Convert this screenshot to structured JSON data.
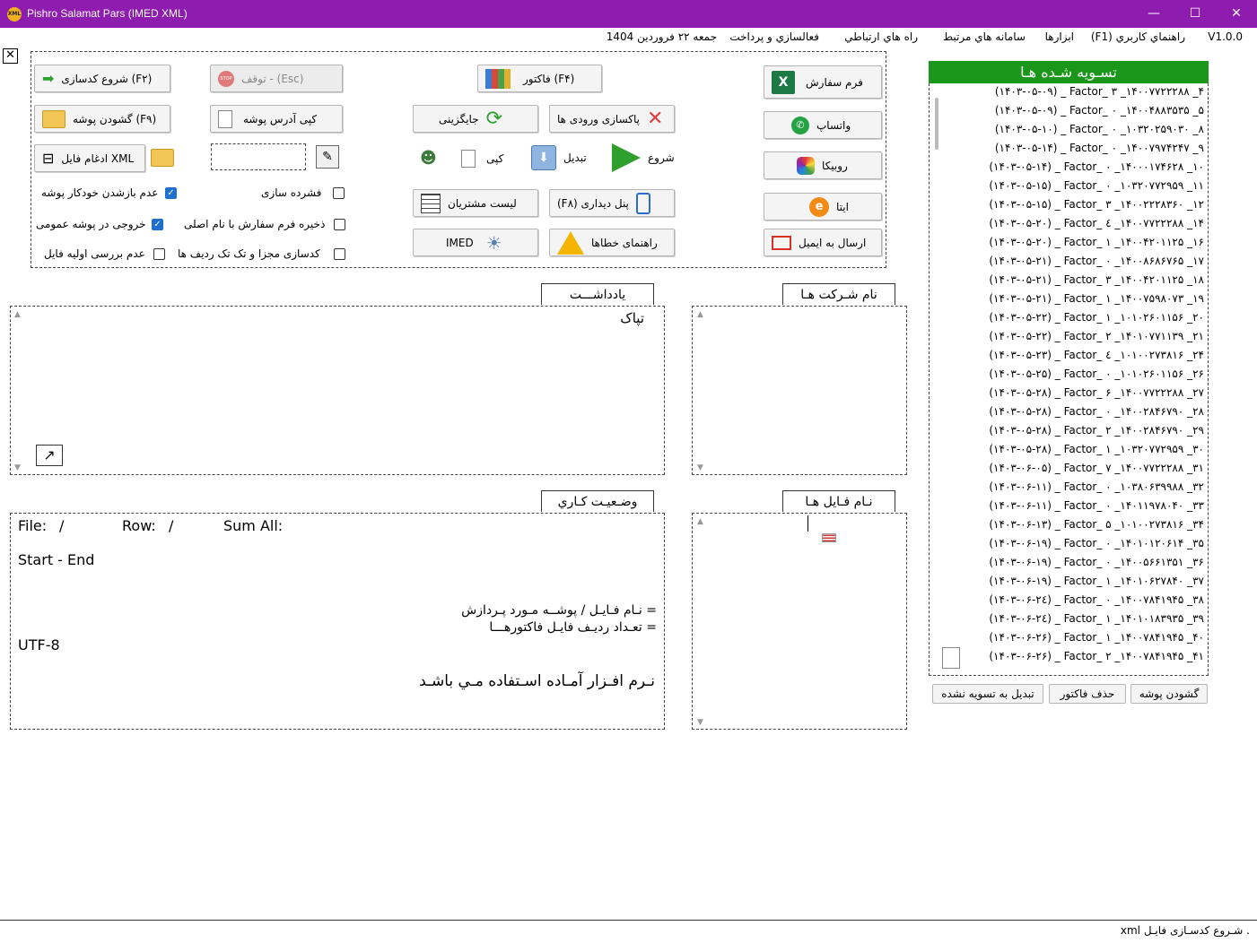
{
  "window": {
    "title": "Pishro Salamat Pars (IMED XML)",
    "app_icon_text": "XML",
    "minimize": "—",
    "maximize": "☐",
    "close": "✕"
  },
  "menu": {
    "version": "V1.0.0",
    "help": "(F1) راهنماي كاربري",
    "tools": "ابزارها",
    "related_systems": "سامانه هاي مرتبط",
    "contact": "راه هاي ارتباطي",
    "activation": "فعالسازي و پرداخت",
    "date": "جمعه ۲۲ فروردین 1404"
  },
  "toolbar": {
    "start_coding": "شروع کدسازی (F۲)",
    "stop": "توقف - (Esc)",
    "invoice": "فاکتور (F۴)",
    "order_form": "فرم سفارش",
    "open_folder": "گشودن پوشه (F۹)",
    "copy_folder_address": "کپی آدرس پوشه",
    "replace": "جایگزینی",
    "clear_inputs": "پاکسازی ورودی ها",
    "whatsapp": "واتساپ",
    "merge_xml": "ادغام فایل XML",
    "copy": "کپی",
    "convert": "تبدیل",
    "start": "شروع",
    "rubika": "روبیکا",
    "customer_list": "لیست مشتریان",
    "view_panel": "(F۸)  پنل دیداری",
    "eita": "ایتا",
    "imed": "IMED",
    "errors_guide": "راهنمای خطاها",
    "send_email": "ارسال به ایمیل",
    "stop_icon_text": "STOP",
    "excel_icon_text": "X",
    "eita_icon_text": "e"
  },
  "options": {
    "no_auto_open_folder": "عدم بازشدن خودکار پوشه",
    "compression": "فشرده سازی",
    "output_general_folder": "خروجی در پوشه عمومی",
    "save_order_form_original": "ذخیره فرم سفارش با نام اصلی",
    "no_initial_check": "عدم بررسی اولیه فایل",
    "separate_coding": "کدسازی مجزا و تک تک ردیف ها"
  },
  "groups": {
    "notes": "یادداشـــت",
    "companies": "نام شـرکت هـا",
    "work_status": "وضـعیـت کـاري",
    "file_names": "نـام فـایل هـا"
  },
  "notes": {
    "text": "تپاک"
  },
  "status": {
    "file_label": "File:",
    "file_sep": "/",
    "row_label": "Row:",
    "row_sep": "/",
    "sum_label": "Sum All:",
    "start_end": "Start  -  End",
    "file_folder": "نـام فـایـل / پوشــه مـورد پـردازش  =",
    "row_count": "تعـداد ردیـف فایـل فاکتورهـــا  =",
    "encoding": "UTF-8",
    "ready": "نـرم افـزار آمـاده اسـتفاده مـي باشـد"
  },
  "settled": {
    "title": "تسـویه شـده هـا",
    "items": [
      "(۱۴۰۳-۰۵-۰۹) _ Factor_ ۳ _۱۴۰۰۷۷۲۲۲۸۸ _۴",
      "(۱۴۰۳-۰۵-۰۹) _ Factor_ ۰ _۱۴۰۰۴۸۸۳۵۳۵ _۵",
      "(۱۴۰۳-۰۵-۱۰) _ Factor_ ۰ _۱۰۳۲۰۲۵۹۰۳۰ _۸",
      "(۱۴۰۳-۰۵-۱۴) _ Factor_ ۰ _۱۴۰۰۷۹۷۴۲۴۷ _۹",
      "(۱۴۰۳-۰۵-۱۴) _ Factor_ ۰ _۱۴۰۰۰۱۷۴۶۲۸ _۱۰",
      "(۱۴۰۳-۰۵-۱۵) _ Factor_ ۰ _۱۰۳۲۰۷۷۲۹۵۹ _۱۱",
      "(۱۴۰۳-۰۵-۱۵) _ Factor_ ۳ _۱۴۰۰۲۲۲۸۳۶۰ _۱۲",
      "(۱۴۰۳-۰۵-۲۰) _ Factor_ ٤ _۱۴۰۰۷۷۲۲۲۸۸ _۱۴",
      "(۱۴۰۳-۰۵-۲۰) _ Factor_ ۱ _۱۴۰۰۴۲۰۱۱۲۵ _۱۶",
      "(۱۴۰۳-۰۵-۲۱) _ Factor_ ۰ _۱۴۰۰۸۶۸۶۷۶۵ _۱۷",
      "(۱۴۰۳-۰۵-۲۱) _ Factor_ ۳ _۱۴۰۰۴۲۰۱۱۲۵ _۱۸",
      "(۱۴۰۳-۰۵-۲۱) _ Factor_ ۱ _۱۴۰۰۷۵۹۸۰۷۳ _۱۹",
      "(۱۴۰۳-۰۵-۲۲) _ Factor_ ۱ _۱۰۱۰۲۶۰۱۱۵۶ _۲۰",
      "(۱۴۰۳-۰۵-۲۲) _ Factor_ ۲ _۱۴۰۱۰۷۷۱۱۳۹ _۲۱",
      "(۱۴۰۳-۰۵-۲۳) _ Factor_ ٤ _۱۰۱۰۰۲۷۳۸۱۶ _۲۴",
      "(۱۴۰۳-۰۵-۲۵) _ Factor_ ۰ _۱۰۱۰۲۶۰۱۱۵۶ _۲۶",
      "(۱۴۰۳-۰۵-۲۸) _ Factor_ ۶ _۱۴۰۰۷۷۲۲۲۸۸ _۲۷",
      "(۱۴۰۳-۰۵-۲۸) _ Factor_ ۰ _۱۴۰۰۲۸۴۶۷۹۰ _۲۸",
      "(۱۴۰۳-۰۵-۲۸) _ Factor_ ۲ _۱۴۰۰۲۸۴۶۷۹۰ _۲۹",
      "(۱۴۰۳-۰۵-۲۸) _ Factor_ ۱ _۱۰۳۲۰۷۷۲۹۵۹ _۳۰",
      "(۱۴۰۳-۰۶-۰۵) _ Factor_ ۷ _۱۴۰۰۷۷۲۲۲۸۸ _۳۱",
      "(۱۴۰۳-۰۶-۱۱) _ Factor_ ۰ _۱۰۳۸۰۶۳۹۹۸۸ _۳۲",
      "(۱۴۰۳-۰۶-۱۱) _ Factor_ ۰ _۱۴۰۱۱۹۷۸۰۴۰ _۳۳",
      "(۱۴۰۳-۰۶-۱۳) _ Factor_ ۵ _۱۰۱۰۰۲۷۳۸۱۶ _۳۴",
      "(۱۴۰۳-۰۶-۱۹) _ Factor_ ۰ _۱۴۰۱۰۱۲۰۶۱۴ _۳۵",
      "(۱۴۰۳-۰۶-۱۹) _ Factor_ ۰ _۱۴۰۰۵۶۶۱۳۵۱ _۳۶",
      "(۱۴۰۳-۰۶-۱۹) _ Factor_ ۱ _۱۴۰۱۰۶۲۷۸۴۰ _۳۷",
      "(۱۴۰۳-۰۶-۲٤) _ Factor_ ۰ _۱۴۰۰۷۸۴۱۹۴۵ _۳۸",
      "(۱۴۰۳-۰۶-۲٤) _ Factor_ ۱ _۱۴۰۱۰۱۸۳۹۳۵ _۳۹",
      "(۱۴۰۳-۰۶-۲۶) _ Factor_ ۱ _۱۴۰۰۷۸۴۱۹۴۵ _۴۰",
      "(۱۴۰۳-۰۶-۲۶) _ Factor_ ۲ _۱۴۰۰۷۸۴۱۹۴۵ _۴۱"
    ],
    "open_folder": "گشودن پوشه",
    "delete_invoice": "حذف فاکتور",
    "convert_unsettled": "تبدیل به تسویه نشده"
  },
  "statusbar": {
    "text": "xml شـروع کدسـازی فایـل ."
  },
  "colors": {
    "titlebar": "#8e1cae",
    "settled_header": "#1a961a"
  }
}
